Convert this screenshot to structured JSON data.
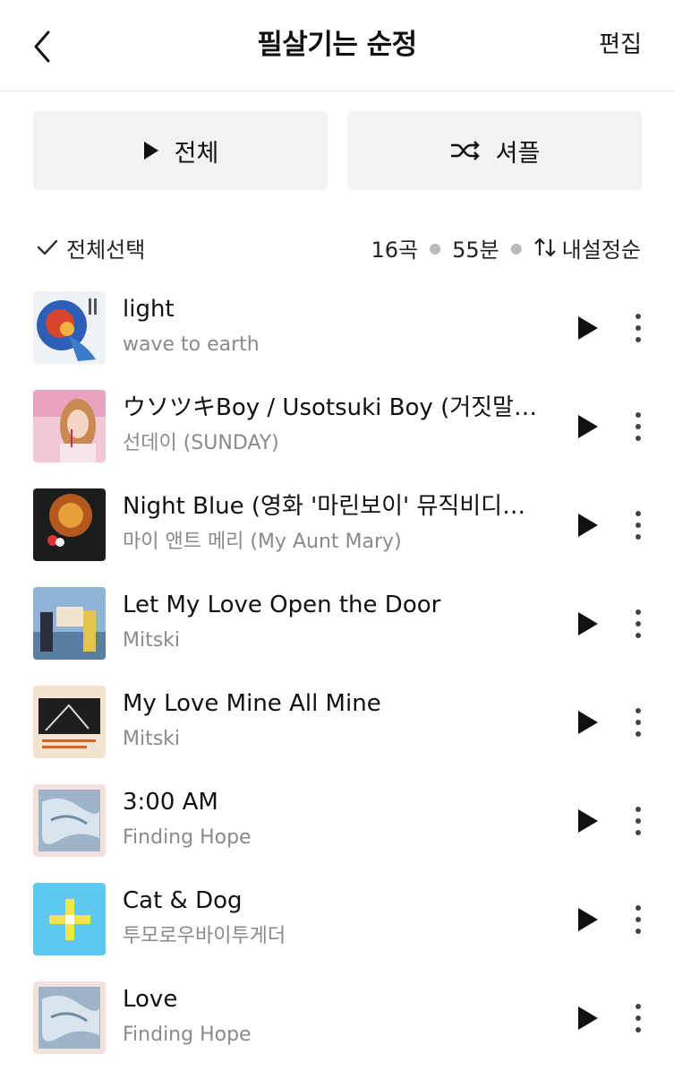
{
  "header": {
    "title": "필살기는 순정",
    "edit_label": "편집"
  },
  "actions": {
    "play_all_label": "전체",
    "shuffle_label": "셔플"
  },
  "summary": {
    "select_all_label": "전체선택",
    "track_count": "16곡",
    "duration": "55분",
    "sort_label": "내설정순"
  },
  "tracks": [
    {
      "title": "light",
      "artist": "wave to earth"
    },
    {
      "title": "ウソツキBoy / Usotsuki Boy (거짓말쟁이 Boy)",
      "artist": "선데이 (SUNDAY)"
    },
    {
      "title": "Night Blue (영화 '마린보이' 뮤직비디오 ...",
      "artist": "마이 앤트 메리 (My Aunt Mary)"
    },
    {
      "title": "Let My Love Open the Door",
      "artist": "Mitski"
    },
    {
      "title": "My Love Mine All Mine",
      "artist": "Mitski"
    },
    {
      "title": "3:00 AM",
      "artist": "Finding Hope"
    },
    {
      "title": "Cat & Dog",
      "artist": "투모로우바이투게더"
    },
    {
      "title": "Love",
      "artist": "Finding Hope"
    }
  ],
  "icons": {
    "back": "chevron-left-icon",
    "play": "play-icon",
    "shuffle": "shuffle-icon",
    "check": "check-icon",
    "sort": "sort-icon",
    "more": "more-vertical-icon"
  },
  "colors": {
    "button_bg": "#f2f2f2",
    "secondary_text": "#8a8a8a",
    "divider": "#ececec"
  }
}
